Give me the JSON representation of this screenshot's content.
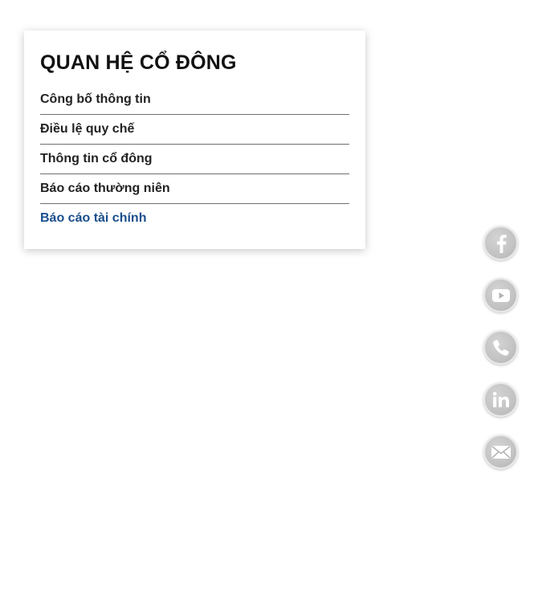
{
  "investor_relations": {
    "title": "QUAN HỆ CỔ ĐÔNG",
    "menu": [
      {
        "label": "Công bố thông tin",
        "active": false
      },
      {
        "label": "Điều lệ quy chế",
        "active": false
      },
      {
        "label": "Thông tin cổ đông",
        "active": false
      },
      {
        "label": "Báo cáo thường niên",
        "active": false
      },
      {
        "label": "Báo cáo tài chính",
        "active": true
      }
    ]
  },
  "social_bar": {
    "buttons": [
      {
        "icon": "facebook-icon"
      },
      {
        "icon": "youtube-icon"
      },
      {
        "icon": "phone-icon"
      },
      {
        "icon": "linkedin-icon"
      },
      {
        "icon": "mail-icon"
      }
    ]
  },
  "colors": {
    "active_link": "#1b4e8c",
    "text": "#222222",
    "icon_bg": "#c6c6c6"
  }
}
